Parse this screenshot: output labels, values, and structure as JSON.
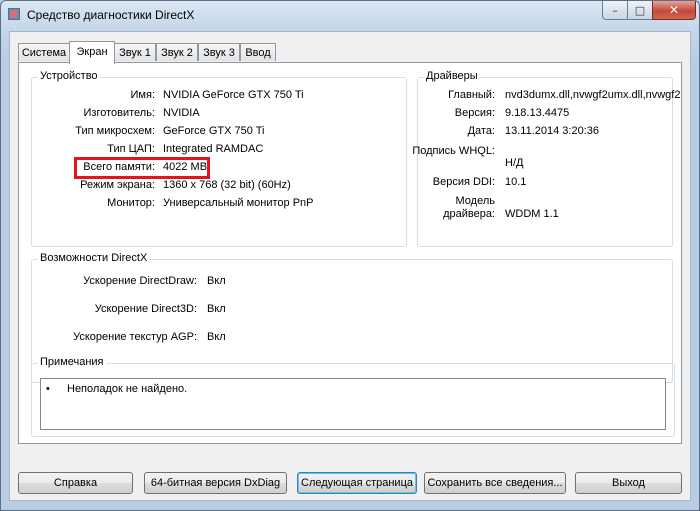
{
  "window": {
    "title": "Средство диагностики DirectX",
    "controls": {
      "minimize": "–",
      "maximize": "□",
      "close": "✕"
    }
  },
  "tabs": [
    {
      "label": "Система"
    },
    {
      "label": "Экран",
      "active": true
    },
    {
      "label": "Звук 1"
    },
    {
      "label": "Звук 2"
    },
    {
      "label": "Звук 3"
    },
    {
      "label": "Ввод"
    }
  ],
  "device": {
    "legend": "Устройство",
    "rows": [
      {
        "label": "Имя:",
        "value": "NVIDIA GeForce GTX 750 Ti"
      },
      {
        "label": "Изготовитель:",
        "value": "NVIDIA"
      },
      {
        "label": "Тип микросхем:",
        "value": "GeForce GTX 750 Ti"
      },
      {
        "label": "Тип ЦАП:",
        "value": "Integrated RAMDAC"
      },
      {
        "label": "Всего памяти:",
        "value": "4022 MB"
      },
      {
        "label": "Режим экрана:",
        "value": "1360 x 768 (32 bit) (60Hz)"
      },
      {
        "label": "Монитор:",
        "value": "Универсальный монитор PnP"
      }
    ]
  },
  "drivers": {
    "legend": "Драйверы",
    "rows": [
      {
        "label": "Главный:",
        "value": "nvd3dumx.dll,nvwgf2umx.dll,nvwgf2"
      },
      {
        "label": "Версия:",
        "value": "9.18.13.4475"
      },
      {
        "label": "Дата:",
        "value": "13.11.2014 3:20:36"
      },
      {
        "label": "Подпись WHQL:",
        "value": "Н/Д"
      },
      {
        "label": "Версия DDI:",
        "value": "10.1"
      },
      {
        "label": "Модель",
        "label2": "драйвера:",
        "value": "WDDM 1.1"
      }
    ]
  },
  "features": {
    "legend": "Возможности DirectX",
    "rows": [
      {
        "label": "Ускорение DirectDraw:",
        "value": "Вкл"
      },
      {
        "label": "Ускорение Direct3D:",
        "value": "Вкл"
      },
      {
        "label": "Ускорение текстур AGP:",
        "value": "Вкл"
      }
    ]
  },
  "notes": {
    "legend": "Примечания",
    "bullet": "•",
    "text": "Неполадок не найдено."
  },
  "buttons": {
    "help": "Справка",
    "dxdiag64": "64-битная версия DxDiag",
    "next": "Следующая страница",
    "save": "Сохранить все сведения...",
    "exit": "Выход"
  },
  "highlight_color": "#e3141e"
}
